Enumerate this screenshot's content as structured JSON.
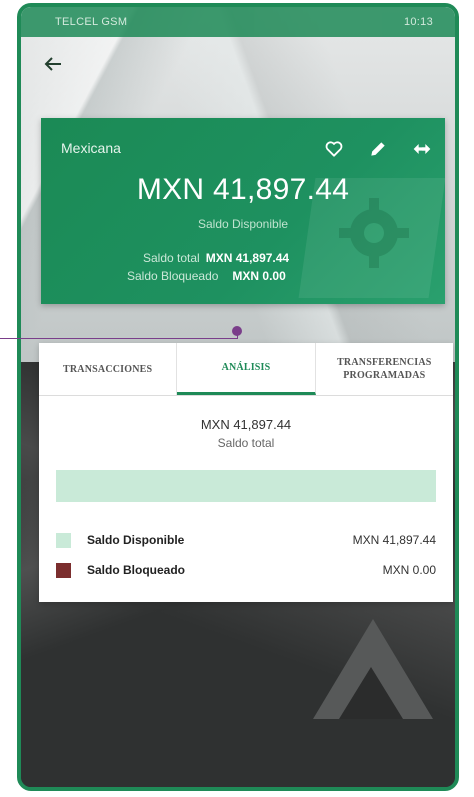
{
  "status_bar": {
    "carrier": "TELCEL GSM",
    "time": "10:13"
  },
  "account": {
    "name": "Mexicana",
    "balance": "MXN 41,897.44",
    "balance_label": "Saldo Disponible",
    "total_label": "Saldo total",
    "total_value": "MXN 41,897.44",
    "blocked_label": "Saldo Bloqueado",
    "blocked_value": "MXN 0.00",
    "actions": [
      "heart-icon",
      "pencil-icon",
      "transfer-icon"
    ]
  },
  "tabs": [
    {
      "label": "TRANSACCIONES",
      "active": false
    },
    {
      "label": "ANÁLISIS",
      "active": true
    },
    {
      "label": "TRANSFERENCIAS PROGRAMADAS",
      "active": false
    }
  ],
  "analysis": {
    "total_amount": "MXN 41,897.44",
    "total_label": "Saldo total",
    "available_fraction": 1.0,
    "legend": [
      {
        "name": "Saldo Disponible",
        "value": "MXN 41,897.44",
        "color": "#c9ead8"
      },
      {
        "name": "Saldo Bloqueado",
        "value": "MXN 0.00",
        "color": "#7b2e2e"
      }
    ]
  },
  "colors": {
    "brand_green": "#1e8a57",
    "callout": "#7a3e8a"
  }
}
